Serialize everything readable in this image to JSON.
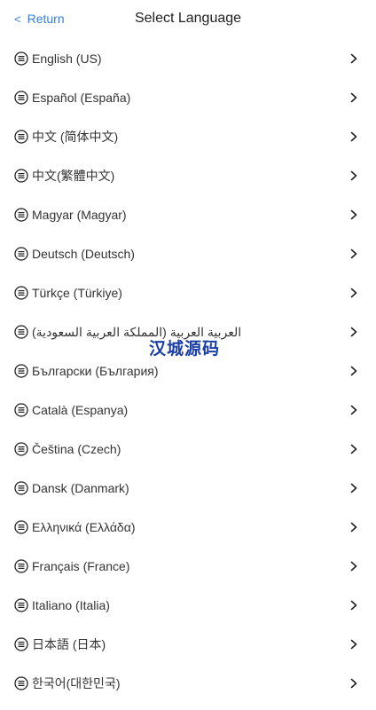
{
  "header": {
    "back_label": "Return",
    "title": "Select Language"
  },
  "languages": [
    {
      "label": "English (US)"
    },
    {
      "label": "Español (España)"
    },
    {
      "label": "中文 (简体中文)"
    },
    {
      "label": "中文(繁體中文)"
    },
    {
      "label": "Magyar (Magyar)"
    },
    {
      "label": "Deutsch (Deutsch)"
    },
    {
      "label": "Türkçe (Türkiye)"
    },
    {
      "label": "العربية العربية (المملكة العربية السعودية)"
    },
    {
      "label": "Български (България)"
    },
    {
      "label": "Català (Espanya)"
    },
    {
      "label": "Čeština (Czech)"
    },
    {
      "label": "Dansk (Danmark)"
    },
    {
      "label": "Ελληνικά (Ελλάδα)"
    },
    {
      "label": "Français (France)"
    },
    {
      "label": "Italiano (Italia)"
    },
    {
      "label": "日本語 (日本)"
    },
    {
      "label": "한국어(대한민국)"
    }
  ],
  "watermark": "汉城源码",
  "icons": {
    "back": "chevron-left-icon",
    "language": "menu-circle-icon",
    "row_arrow": "chevron-right-icon"
  },
  "colors": {
    "accent": "#3a7fd5",
    "title": "#222222",
    "text": "#333333",
    "watermark": "#1a3ea8"
  }
}
